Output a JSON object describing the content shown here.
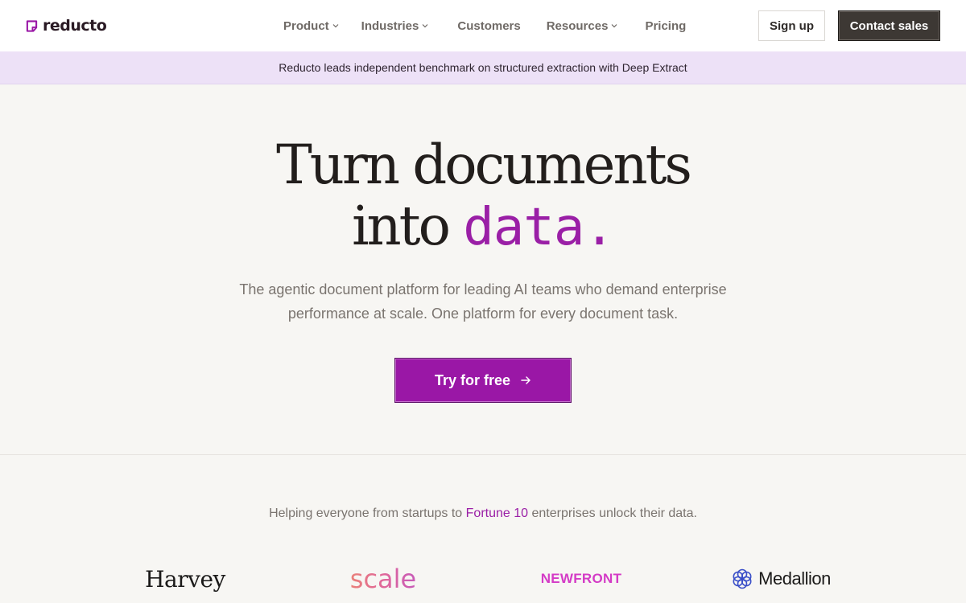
{
  "brand": {
    "name": "reducto",
    "accent_color": "#9a17a6",
    "logo_icon": "folded-page-icon"
  },
  "nav": {
    "items": [
      {
        "label": "Product",
        "has_dropdown": true
      },
      {
        "label": "Industries",
        "has_dropdown": true
      },
      {
        "label": "Customers",
        "has_dropdown": false
      },
      {
        "label": "Resources",
        "has_dropdown": true
      },
      {
        "label": "Pricing",
        "has_dropdown": false
      }
    ],
    "signup_label": "Sign up",
    "contact_label": "Contact sales"
  },
  "banner": {
    "text": "Reducto leads independent benchmark on structured extraction with Deep Extract",
    "background": "#ede1f7"
  },
  "hero": {
    "title_line1": "Turn documents",
    "title_line2_prefix": "into ",
    "title_accent": "data.",
    "subtitle_line1": "The agentic document platform for leading AI teams who demand enterprise",
    "subtitle_line2": "performance at scale. One platform for every document task.",
    "cta_label": "Try for free",
    "cta_icon": "arrow-right-icon"
  },
  "customers": {
    "caption_prefix": "Helping everyone from startups to ",
    "caption_highlight": "Fortune 10",
    "caption_suffix": " enterprises unlock their data.",
    "logos": [
      {
        "name": "Harvey"
      },
      {
        "name": "scale"
      },
      {
        "name": "NEWFRONT"
      },
      {
        "name": "Medallion",
        "icon": "medallion-knot-icon"
      }
    ]
  }
}
